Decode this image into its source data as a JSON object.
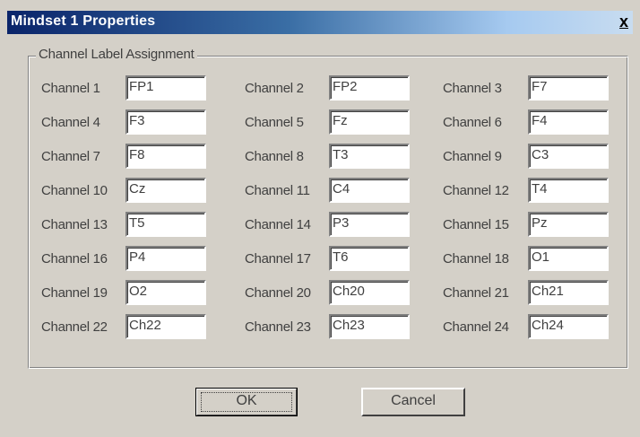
{
  "window": {
    "title": "Mindset 1 Properties",
    "close_label": "x"
  },
  "group": {
    "legend": "Channel Label Assignment"
  },
  "channels": [
    {
      "label": "Channel 1",
      "value": "FP1"
    },
    {
      "label": "Channel 2",
      "value": "FP2"
    },
    {
      "label": "Channel 3",
      "value": "F7"
    },
    {
      "label": "Channel 4",
      "value": "F3"
    },
    {
      "label": "Channel 5",
      "value": "Fz"
    },
    {
      "label": "Channel 6",
      "value": "F4"
    },
    {
      "label": "Channel 7",
      "value": "F8"
    },
    {
      "label": "Channel 8",
      "value": "T3"
    },
    {
      "label": "Channel 9",
      "value": "C3"
    },
    {
      "label": "Channel 10",
      "value": "Cz"
    },
    {
      "label": "Channel 11",
      "value": "C4"
    },
    {
      "label": "Channel 12",
      "value": "T4"
    },
    {
      "label": "Channel 13",
      "value": "T5"
    },
    {
      "label": "Channel 14",
      "value": "P3"
    },
    {
      "label": "Channel 15",
      "value": "Pz"
    },
    {
      "label": "Channel 16",
      "value": "P4"
    },
    {
      "label": "Channel 17",
      "value": "T6"
    },
    {
      "label": "Channel 18",
      "value": "O1"
    },
    {
      "label": "Channel 19",
      "value": "O2"
    },
    {
      "label": "Channel 20",
      "value": "Ch20"
    },
    {
      "label": "Channel 21",
      "value": "Ch21"
    },
    {
      "label": "Channel 22",
      "value": "Ch22"
    },
    {
      "label": "Channel 23",
      "value": "Ch23"
    },
    {
      "label": "Channel 24",
      "value": "Ch24"
    }
  ],
  "buttons": {
    "ok_label": "OK",
    "cancel_label": "Cancel"
  },
  "colors": {
    "title_bar_start": "#0a246a",
    "title_bar_end": "#a6caf0",
    "dialog_face": "#d4d0c8"
  }
}
